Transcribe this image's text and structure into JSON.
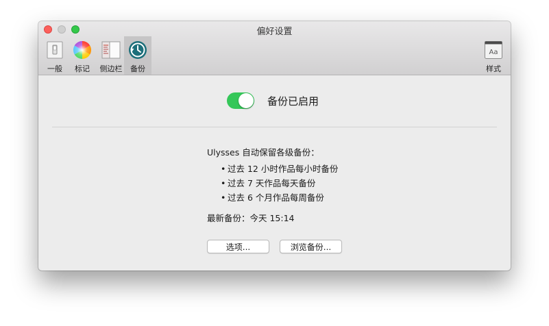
{
  "window": {
    "title": "偏好设置"
  },
  "toolbar": {
    "items": [
      {
        "label": "一般",
        "icon": "general-switch-icon"
      },
      {
        "label": "标记",
        "icon": "color-wheel-icon"
      },
      {
        "label": "侧边栏",
        "icon": "sidebar-icon"
      },
      {
        "label": "备份",
        "icon": "backup-clock-icon",
        "active": true
      },
      {
        "label": "样式",
        "icon": "style-aa-icon"
      }
    ]
  },
  "backup": {
    "toggle_on": true,
    "toggle_label": "备份已启用",
    "intro": "Ulysses 自动保留各级备份：",
    "list": [
      "过去 12 小时作品每小时备份",
      "过去 7 天作品每天备份",
      "过去 6 个月作品每周备份"
    ],
    "latest": "最新备份：今天 15:14",
    "options_button": "选项...",
    "browse_button": "浏览备份..."
  },
  "colors": {
    "toggle_on": "#35c759",
    "active_tool_bg": "#c6c5c6",
    "close": "#fc605c",
    "maximize": "#34c84a"
  }
}
